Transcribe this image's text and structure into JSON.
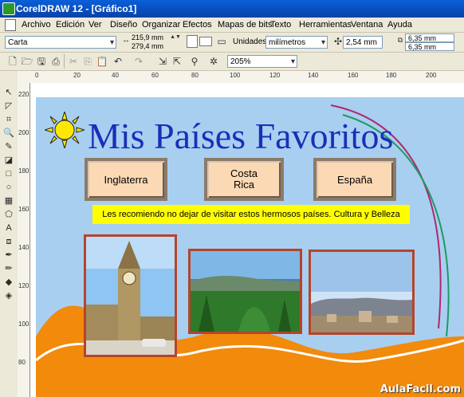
{
  "window": {
    "title": "CorelDRAW 12 - [Gráfico1]"
  },
  "menu": [
    "Archivo",
    "Edición",
    "Ver",
    "Diseño",
    "Organizar",
    "Efectos",
    "Mapas de bits",
    "Texto",
    "Herramientas",
    "Ventana",
    "Ayuda"
  ],
  "toolbar1": {
    "paper_size": "Carta",
    "width": "215,9 mm",
    "height": "279,4 mm",
    "units_label": "Unidades:",
    "units_value": "milímetros",
    "nudge": "2,54 mm",
    "dup_x": "6,35 mm",
    "dup_y": "6,35 mm"
  },
  "toolbar2": {
    "zoom": "205%"
  },
  "ruler": {
    "h_ticks": [
      "0",
      "20",
      "40",
      "60",
      "80",
      "100",
      "120",
      "140",
      "160",
      "180",
      "200"
    ],
    "v_ticks": [
      "220",
      "200",
      "180",
      "160",
      "140",
      "120",
      "100",
      "80"
    ]
  },
  "page": {
    "title": "Mis Países Favoritos",
    "buttons": [
      "Inglaterra",
      "Costa Rica",
      "España"
    ],
    "banner": "Les recomiendo no dejar de visitar estos hermosos países. Cultura y Belleza",
    "photos": [
      "big-ben-photo",
      "costa-rica-photo",
      "spain-photo"
    ]
  },
  "watermark": "AulaFacil.com",
  "colors": {
    "title": "#1a2fb8",
    "background": "#a8cff0",
    "button": "#fbd9b4",
    "banner": "#ffff00",
    "wave": "#f28a0c",
    "frame": "#b5442a"
  }
}
